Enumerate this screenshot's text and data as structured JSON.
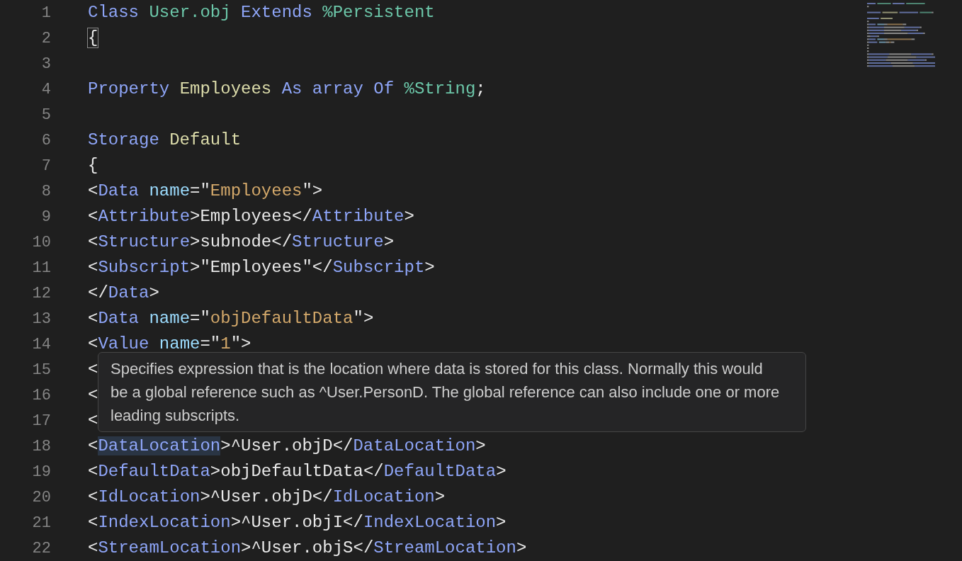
{
  "editor": {
    "lines": [
      {
        "number": "1",
        "tokens": [
          {
            "kind": "keyword",
            "text": "Class "
          },
          {
            "kind": "class",
            "text": "User.obj "
          },
          {
            "kind": "keyword",
            "text": "Extends "
          },
          {
            "kind": "class",
            "text": "%Persistent"
          }
        ]
      },
      {
        "number": "2",
        "tokens": [
          {
            "kind": "bracket",
            "text": "{",
            "boxed": true
          }
        ]
      },
      {
        "number": "3"
      },
      {
        "number": "4",
        "tokens": [
          {
            "kind": "keyword",
            "text": "Property "
          },
          {
            "kind": "name",
            "text": "Employees "
          },
          {
            "kind": "keyword",
            "text": "As array Of "
          },
          {
            "kind": "class",
            "text": "%String"
          },
          {
            "kind": "text",
            "text": ";"
          }
        ]
      },
      {
        "number": "5"
      },
      {
        "number": "6",
        "tokens": [
          {
            "kind": "keyword",
            "text": "Storage "
          },
          {
            "kind": "name",
            "text": "Default"
          }
        ]
      },
      {
        "number": "7",
        "tokens": [
          {
            "kind": "text",
            "text": "{"
          }
        ]
      },
      {
        "number": "8",
        "tokens": [
          {
            "kind": "text",
            "text": "<"
          },
          {
            "kind": "tag",
            "text": "Data "
          },
          {
            "kind": "attr",
            "text": "name"
          },
          {
            "kind": "text",
            "text": "=\""
          },
          {
            "kind": "string",
            "text": "Employees"
          },
          {
            "kind": "text",
            "text": "\">"
          }
        ]
      },
      {
        "number": "9",
        "tokens": [
          {
            "kind": "text",
            "text": "<"
          },
          {
            "kind": "tag",
            "text": "Attribute"
          },
          {
            "kind": "text",
            "text": ">Employees</"
          },
          {
            "kind": "tag",
            "text": "Attribute"
          },
          {
            "kind": "text",
            "text": ">"
          }
        ]
      },
      {
        "number": "10",
        "tokens": [
          {
            "kind": "text",
            "text": "<"
          },
          {
            "kind": "tag",
            "text": "Structure"
          },
          {
            "kind": "text",
            "text": ">subnode</"
          },
          {
            "kind": "tag",
            "text": "Structure"
          },
          {
            "kind": "text",
            "text": ">"
          }
        ]
      },
      {
        "number": "11",
        "tokens": [
          {
            "kind": "text",
            "text": "<"
          },
          {
            "kind": "tag",
            "text": "Subscript"
          },
          {
            "kind": "text",
            "text": ">\"Employees\"</"
          },
          {
            "kind": "tag",
            "text": "Subscript"
          },
          {
            "kind": "text",
            "text": ">"
          }
        ]
      },
      {
        "number": "12",
        "tokens": [
          {
            "kind": "text",
            "text": "</"
          },
          {
            "kind": "tag",
            "text": "Data"
          },
          {
            "kind": "text",
            "text": ">"
          }
        ]
      },
      {
        "number": "13",
        "tokens": [
          {
            "kind": "text",
            "text": "<"
          },
          {
            "kind": "tag",
            "text": "Data "
          },
          {
            "kind": "attr",
            "text": "name"
          },
          {
            "kind": "text",
            "text": "=\""
          },
          {
            "kind": "string",
            "text": "objDefaultData"
          },
          {
            "kind": "text",
            "text": "\">"
          }
        ]
      },
      {
        "number": "14",
        "tokens": [
          {
            "kind": "text",
            "text": "<"
          },
          {
            "kind": "tag",
            "text": "Value "
          },
          {
            "kind": "attr",
            "text": "name"
          },
          {
            "kind": "text",
            "text": "=\""
          },
          {
            "kind": "string",
            "text": "1"
          },
          {
            "kind": "text",
            "text": "\">"
          }
        ]
      },
      {
        "number": "15",
        "tokens": [
          {
            "kind": "text",
            "text": "<"
          }
        ]
      },
      {
        "number": "16",
        "tokens": [
          {
            "kind": "text",
            "text": "<"
          }
        ]
      },
      {
        "number": "17",
        "tokens": [
          {
            "kind": "text",
            "text": "<"
          }
        ]
      },
      {
        "number": "18",
        "tokens": [
          {
            "kind": "text",
            "text": "<"
          },
          {
            "kind": "tag",
            "text": "DataLocation",
            "hovered": true
          },
          {
            "kind": "text",
            "text": ">^User.objD</"
          },
          {
            "kind": "tag",
            "text": "DataLocation"
          },
          {
            "kind": "text",
            "text": ">"
          }
        ]
      },
      {
        "number": "19",
        "tokens": [
          {
            "kind": "text",
            "text": "<"
          },
          {
            "kind": "tag",
            "text": "DefaultData"
          },
          {
            "kind": "text",
            "text": ">objDefaultData</"
          },
          {
            "kind": "tag",
            "text": "DefaultData"
          },
          {
            "kind": "text",
            "text": ">"
          }
        ]
      },
      {
        "number": "20",
        "tokens": [
          {
            "kind": "text",
            "text": "<"
          },
          {
            "kind": "tag",
            "text": "IdLocation"
          },
          {
            "kind": "text",
            "text": ">^User.objD</"
          },
          {
            "kind": "tag",
            "text": "IdLocation"
          },
          {
            "kind": "text",
            "text": ">"
          }
        ]
      },
      {
        "number": "21",
        "tokens": [
          {
            "kind": "text",
            "text": "<"
          },
          {
            "kind": "tag",
            "text": "IndexLocation"
          },
          {
            "kind": "text",
            "text": ">^User.objI</"
          },
          {
            "kind": "tag",
            "text": "IndexLocation"
          },
          {
            "kind": "text",
            "text": ">"
          }
        ]
      },
      {
        "number": "22",
        "tokens": [
          {
            "kind": "text",
            "text": "<"
          },
          {
            "kind": "tag",
            "text": "StreamLocation"
          },
          {
            "kind": "text",
            "text": ">^User.objS</"
          },
          {
            "kind": "tag",
            "text": "StreamLocation"
          },
          {
            "kind": "text",
            "text": ">"
          }
        ]
      }
    ]
  },
  "hover_tooltip": {
    "text": "Specifies expression that is the location where data is stored for this class. Normally this would be a global reference such as ^User.PersonD. The global reference can also include one or more leading subscripts."
  }
}
